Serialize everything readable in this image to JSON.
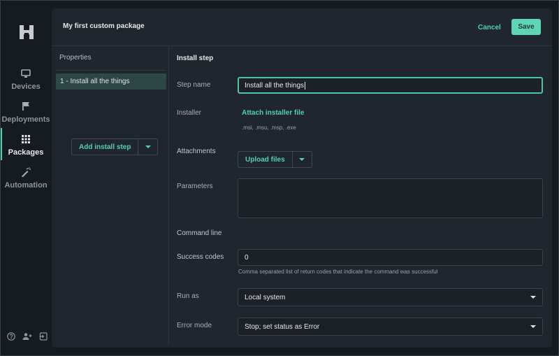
{
  "nav": {
    "logo": "app-logo",
    "items": [
      {
        "label": "Devices",
        "icon": "monitor-icon",
        "active": false
      },
      {
        "label": "Deployments",
        "icon": "flag-icon",
        "active": false
      },
      {
        "label": "Packages",
        "icon": "grid-icon",
        "active": true
      },
      {
        "label": "Automation",
        "icon": "magic-wand-icon",
        "active": false
      }
    ],
    "bottom_icons": [
      "help-icon",
      "add-user-icon",
      "sign-out-icon"
    ]
  },
  "header": {
    "title": "My first custom package",
    "cancel_label": "Cancel",
    "save_label": "Save"
  },
  "properties": {
    "title": "Properties",
    "items": [
      {
        "label": "1 - Install all the things",
        "selected": true
      }
    ],
    "add_button_label": "Add install step"
  },
  "form": {
    "title": "Install step",
    "step_name": {
      "label": "Step name",
      "value": "Install all the things"
    },
    "installer": {
      "label": "Installer",
      "link": "Attach installer file",
      "hint": ".msi, .msu, .msp, .exe"
    },
    "attachments": {
      "label": "Attachments",
      "button_label": "Upload files"
    },
    "parameters": {
      "label": "Parameters",
      "value": ""
    },
    "command_line": {
      "label": "Command line"
    },
    "success_codes": {
      "label": "Success codes",
      "value": "0",
      "hint": "Comma separated list of return codes that indicate the command was successful"
    },
    "run_as": {
      "label": "Run as",
      "value": "Local system"
    },
    "error_mode": {
      "label": "Error mode",
      "value": "Stop; set status as Error"
    }
  },
  "colors": {
    "accent": "#4fd1b1",
    "background": "#161b21",
    "card": "#20262d",
    "selected_item": "#2d4747"
  }
}
